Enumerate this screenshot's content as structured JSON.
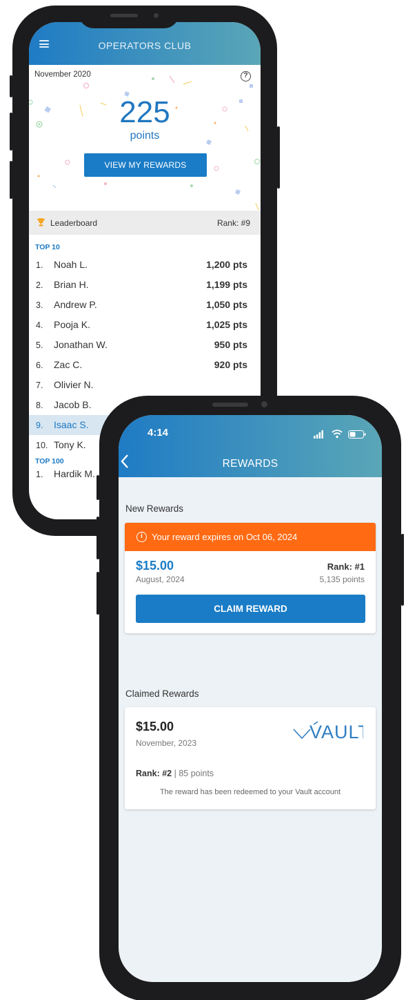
{
  "phone1": {
    "app_title": "OPERATORS CLUB",
    "month": "November 2020",
    "points_value": "225",
    "points_label": "points",
    "view_rewards_label": "VIEW MY REWARDS",
    "leaderboard": {
      "title": "Leaderboard",
      "rank_label": "Rank: #9",
      "top10_label": "TOP 10",
      "rows": [
        {
          "num": "1.",
          "name": "Noah L.",
          "pts": "1,200 pts"
        },
        {
          "num": "2.",
          "name": "Brian H.",
          "pts": "1,199 pts"
        },
        {
          "num": "3.",
          "name": "Andrew P.",
          "pts": "1,050 pts"
        },
        {
          "num": "4.",
          "name": "Pooja K.",
          "pts": "1,025 pts"
        },
        {
          "num": "5.",
          "name": "Jonathan W.",
          "pts": "950 pts"
        },
        {
          "num": "6.",
          "name": "Zac C.",
          "pts": "920 pts"
        },
        {
          "num": "7.",
          "name": "Olivier N.",
          "pts": ""
        },
        {
          "num": "8.",
          "name": "Jacob B.",
          "pts": ""
        },
        {
          "num": "9.",
          "name": "Isaac S.",
          "pts": ""
        },
        {
          "num": "10.",
          "name": "Tony K.",
          "pts": ""
        }
      ],
      "top100_label": "TOP 100",
      "top100_first": {
        "num": "1.",
        "name": "Hardik M."
      }
    }
  },
  "phone2": {
    "status_time": "4:14",
    "title": "REWARDS",
    "new_rewards_heading": "New Rewards",
    "expire_text": "Your reward expires on Oct 06, 2024",
    "new_reward": {
      "amount": "$15.00",
      "date": "August, 2024",
      "rank": "Rank: #1",
      "points": "5,135 points",
      "claim_label": "CLAIM REWARD"
    },
    "claimed_heading": "Claimed Rewards",
    "claimed_reward": {
      "amount": "$15.00",
      "date": "November, 2023",
      "rank": "Rank: #2",
      "separator": " | ",
      "points": "85 points",
      "note": "The reward has been redeemed to your Vault account",
      "logo_text": "VAULT"
    }
  },
  "colors": {
    "brand_blue": "#1a7cc6",
    "gradient_end": "#5aa6b7",
    "expire_orange": "#ff6a13",
    "highlight_row": "#d8e6f2",
    "screen_bg": "#edf2f6",
    "vault_blue": "#2f7ec3"
  }
}
